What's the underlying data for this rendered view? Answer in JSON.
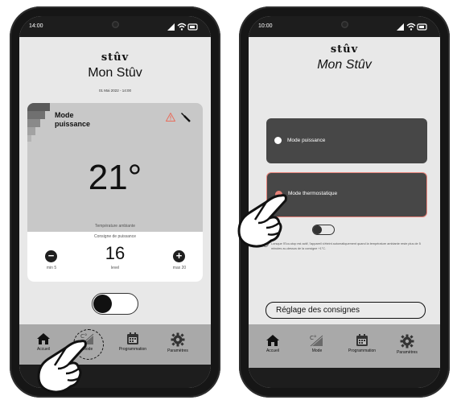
{
  "left_screen": {
    "status_time": "14:00",
    "brand": "stûv",
    "title": "Mon Stûv",
    "date": "01 Mai 2022  -  14:00",
    "mode_label_line1": "Mode",
    "mode_label_line2": "puissance",
    "temperature": "21°",
    "temperature_caption": "Température ambiante",
    "setpoint_caption": "Consigne de puissance",
    "power_level": "16",
    "level_label": "level",
    "min_label": "min 5",
    "max_label": "max 20",
    "tabs": [
      {
        "label": "Accueil",
        "icon": "home-icon"
      },
      {
        "label": "Mode",
        "icon": "mode-icon"
      },
      {
        "label": "Programmation",
        "icon": "calendar-icon"
      },
      {
        "label": "Paramètres",
        "icon": "gear-icon"
      }
    ]
  },
  "right_screen": {
    "status_time": "10:00",
    "brand": "stûv",
    "title": "Mon Stûv",
    "option_power": "Mode puissance",
    "option_thermo": "Mode thermostatique",
    "eco_stop_label": "o-stop",
    "eco_info": "Lorsque l'Eco-stop est actif, l'appareil s'éteint automatiquement quand la température ambiante reste plus de 5 minutes au-dessus de la consigne +1°C.",
    "reglage_button": "Réglage des consignes",
    "tabs": [
      {
        "label": "Accueil",
        "icon": "home-icon"
      },
      {
        "label": "Mode",
        "icon": "mode-icon"
      },
      {
        "label": "Programmation",
        "icon": "calendar-icon"
      },
      {
        "label": "Paramètres",
        "icon": "gear-icon"
      }
    ]
  },
  "colors": {
    "accent_border": "#e9837a",
    "dark_button": "#474747",
    "tabbar": "#a9a9a9",
    "warning": "#e76f5e"
  }
}
